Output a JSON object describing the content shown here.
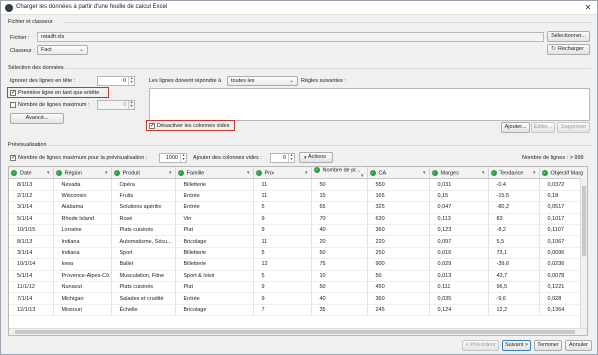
{
  "window": {
    "title": "Charger les données à partir d'une feuille de calcul Excel",
    "close_glyph": "✕"
  },
  "file_section": {
    "title": "Fichier et classeur",
    "file_label": "Fichier :",
    "file_value": "retailfr.xls",
    "select_button": "Sélectionner...",
    "sheet_label": "Classeur :",
    "sheet_value": "Fact",
    "reload_button": "Recharger",
    "reload_icon": "refresh-icon"
  },
  "selection_section": {
    "title": "Sélection des données",
    "ignore_label": "Ignorer des lignes en tête :",
    "ignore_value": "0",
    "first_row_header_label": "Première ligne en tant que entête",
    "first_row_header_checked": true,
    "max_rows_label": "Nombre de lignes maximum :",
    "max_rows_checked": false,
    "max_rows_value": "0",
    "advanced_button": "Avancé...",
    "rule_label": "Les lignes doivent répondre à",
    "rule_value": "toutes les",
    "rule_suffix": "Règles suivantes :",
    "disable_empty_cols_label": "Désactiver les colonnes vides",
    "disable_empty_cols_checked": true,
    "add_button": "Ajouter...",
    "edit_button": "Éditer...",
    "delete_button": "Supprimer"
  },
  "preview_section": {
    "title": "Prévisualisation",
    "max_preview_label": "Nombre de lignes maximum pour la prévisualisation :",
    "max_preview_checked": true,
    "max_preview_value": "1000",
    "empty_cols_label": "Ajouter des colonnes vides :",
    "empty_cols_value": "0",
    "actions_button": "Actions",
    "row_count": "Nombre de lignes : > 999"
  },
  "table": {
    "columns": [
      "Date",
      "Région",
      "Produit",
      "Famille",
      "Prix",
      "Nombre de pr...",
      "CA",
      "Marges",
      "Tendance",
      "Objectif Marg"
    ],
    "rows": [
      [
        "8/1/13",
        "Nevada",
        "Opéra",
        "Billetterie",
        "11",
        "50",
        "550",
        "0,031",
        "-0,4",
        "0,0372"
      ],
      [
        "2/1/12",
        "Wisconsin",
        "Fruits",
        "Entrée",
        "11",
        "15",
        "165",
        "0,15",
        "-15,5",
        "0,18"
      ],
      [
        "3/1/14",
        "Alabama",
        "Solutions apéritiv",
        "Entrée",
        "5",
        "65",
        "325",
        "0,047",
        "-80,2",
        "0,0517"
      ],
      [
        "5/1/14",
        "Rhode Island",
        "Rosé",
        "Vin",
        "9",
        "70",
        "630",
        "0,113",
        "83",
        "0,1017"
      ],
      [
        "10/1/15",
        "Lorraine",
        "Plats cuisinés",
        "Plat",
        "9",
        "40",
        "360",
        "0,123",
        "-8,2",
        "0,1107"
      ],
      [
        "8/1/13",
        "Indiana",
        "Automatisme, Sécu...",
        "Bricolage",
        "11",
        "20",
        "220",
        "0,097",
        "5,5",
        "0,1067"
      ],
      [
        "3/1/14",
        "Indiana",
        "Sport",
        "Billetterie",
        "5",
        "50",
        "250",
        "0,016",
        "73,1",
        "0,0096"
      ],
      [
        "10/1/14",
        "Iowa",
        "Ballet",
        "Billetterie",
        "12",
        "75",
        "900",
        "0,029",
        "-39,6",
        "0,0236"
      ],
      [
        "5/1/14",
        "Provence-Alpes-Cô...",
        "Musculation, Fitne",
        "Sport & loisir",
        "5",
        "10",
        "50",
        "0,013",
        "43,7",
        "0,0078"
      ],
      [
        "11/1/12",
        "Nunavut",
        "Plats cuisinés",
        "Plat",
        "9",
        "50",
        "450",
        "0,111",
        "96,5",
        "0,1221"
      ],
      [
        "7/1/14",
        "Michigan",
        "Salades et crudité",
        "Entrée",
        "9",
        "40",
        "360",
        "0,035",
        "-9,6",
        "0,028"
      ],
      [
        "12/1/13",
        "Missouri",
        "Échelle",
        "Bricolage",
        "7",
        "35",
        "245",
        "0,124",
        "12,2",
        "0,1364"
      ]
    ]
  },
  "footer": {
    "prev_button": "< Précédent",
    "next_button": "Suivant >",
    "finish_button": "Terminer",
    "cancel_button": "Annuler"
  }
}
